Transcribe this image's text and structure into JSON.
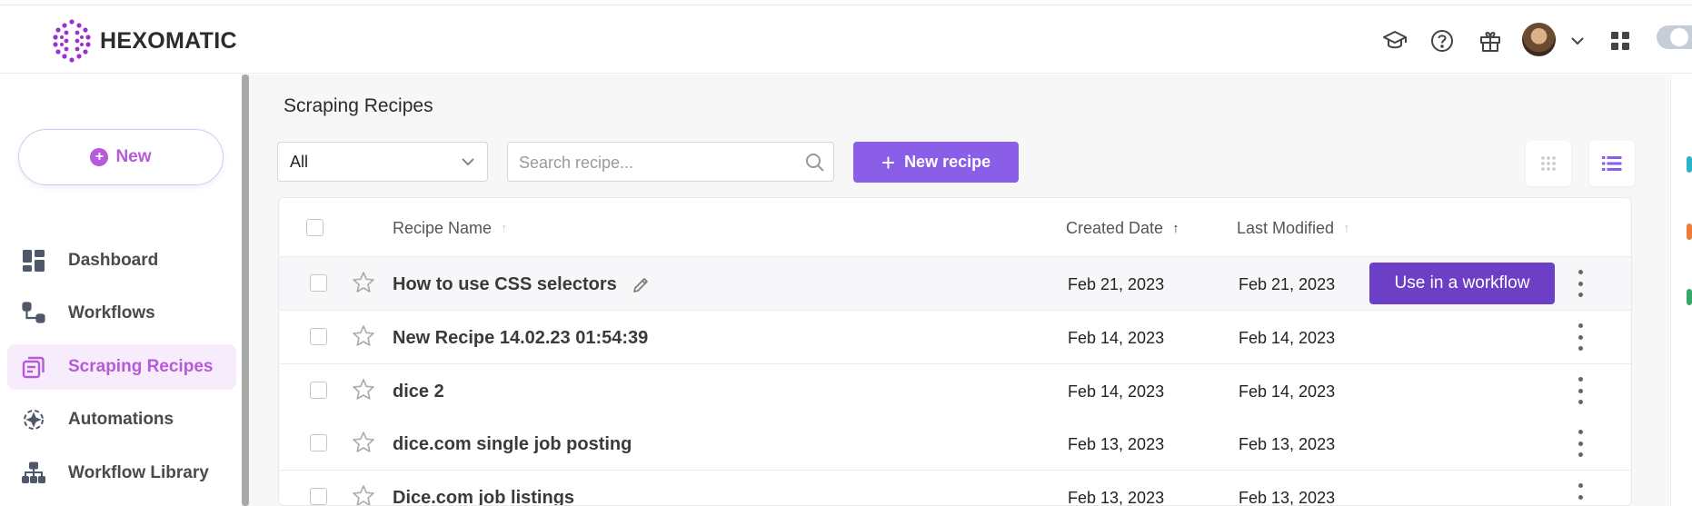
{
  "app": {
    "logo_text": "HEXOMATIC",
    "accent": "#b55ad8",
    "primary_button_color": "#8a5ee6",
    "workflow_button_color": "#6c3fc6"
  },
  "header": {
    "icons": [
      "graduation-cap-icon",
      "help-icon",
      "gift-icon",
      "chevron-down-icon",
      "apps-grid-icon"
    ]
  },
  "sidebar": {
    "new_label": "New",
    "items": [
      {
        "label": "Dashboard",
        "icon": "dashboard-icon",
        "active": false
      },
      {
        "label": "Workflows",
        "icon": "workflows-icon",
        "active": false
      },
      {
        "label": "Scraping Recipes",
        "icon": "recipes-icon",
        "active": true
      },
      {
        "label": "Automations",
        "icon": "automations-icon",
        "active": false
      },
      {
        "label": "Workflow Library",
        "icon": "library-icon",
        "active": false
      }
    ]
  },
  "main": {
    "title": "Scraping Recipes",
    "filter": {
      "selected": "All"
    },
    "search": {
      "placeholder": "Search recipe..."
    },
    "new_recipe_label": "New recipe",
    "table": {
      "columns": {
        "name": "Recipe Name",
        "created": "Created Date",
        "modified": "Last Modified"
      },
      "use_in_workflow_label": "Use in a workflow",
      "rows": [
        {
          "name": "How to use CSS selectors",
          "created": "Feb 21, 2023",
          "modified": "Feb 21, 2023"
        },
        {
          "name": "New Recipe 14.02.23 01:54:39",
          "created": "Feb 14, 2023",
          "modified": "Feb 14, 2023"
        },
        {
          "name": "dice 2",
          "created": "Feb 14, 2023",
          "modified": "Feb 14, 2023"
        },
        {
          "name": "dice.com single job posting",
          "created": "Feb 13, 2023",
          "modified": "Feb 13, 2023"
        },
        {
          "name": "Dice.com job listings",
          "created": "Feb 13, 2023",
          "modified": "Feb 13, 2023"
        }
      ]
    }
  }
}
